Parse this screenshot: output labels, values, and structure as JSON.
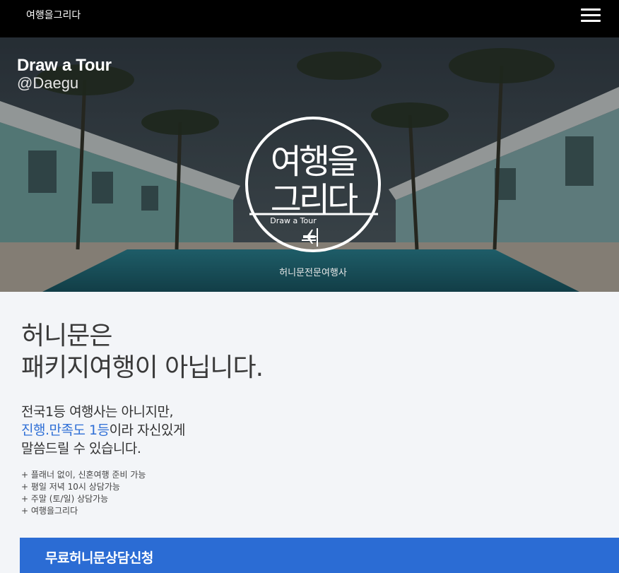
{
  "header": {
    "brand": "여행을그리다",
    "menu_icon": "hamburger-menu-icon"
  },
  "hero": {
    "title": "Draw a Tour",
    "subtitle": "@Daegu",
    "logo": {
      "text_line1": "여행을",
      "text_line2": "그리다",
      "text_en": "Draw a Tour",
      "icon": "airplane-icon"
    },
    "caption": "허니문전문여행사"
  },
  "main": {
    "headline_line1": "허니문은",
    "headline_line2": "패키지여행이 아닙니다.",
    "pitch_line1": "전국1등 여행사는 아니지만,",
    "pitch_line2_highlight": "진행.만족도 1등",
    "pitch_line2_rest": "이라 자신있게",
    "pitch_line3": "말씀드릴 수 있습니다.",
    "features": [
      "+ 플래너 없이, 신혼여행 준비 가능",
      "+ 평일 저녁 10시 상담가능",
      "+ 주말 (토/일) 상담가능",
      "+ 여행을그리다"
    ],
    "cta_label": "무료허니문상담신청"
  },
  "colors": {
    "accent": "#2b6cd4",
    "highlight_text": "#2f6fd6",
    "topbar": "#000000",
    "page_bg": "#f3f5f8"
  }
}
